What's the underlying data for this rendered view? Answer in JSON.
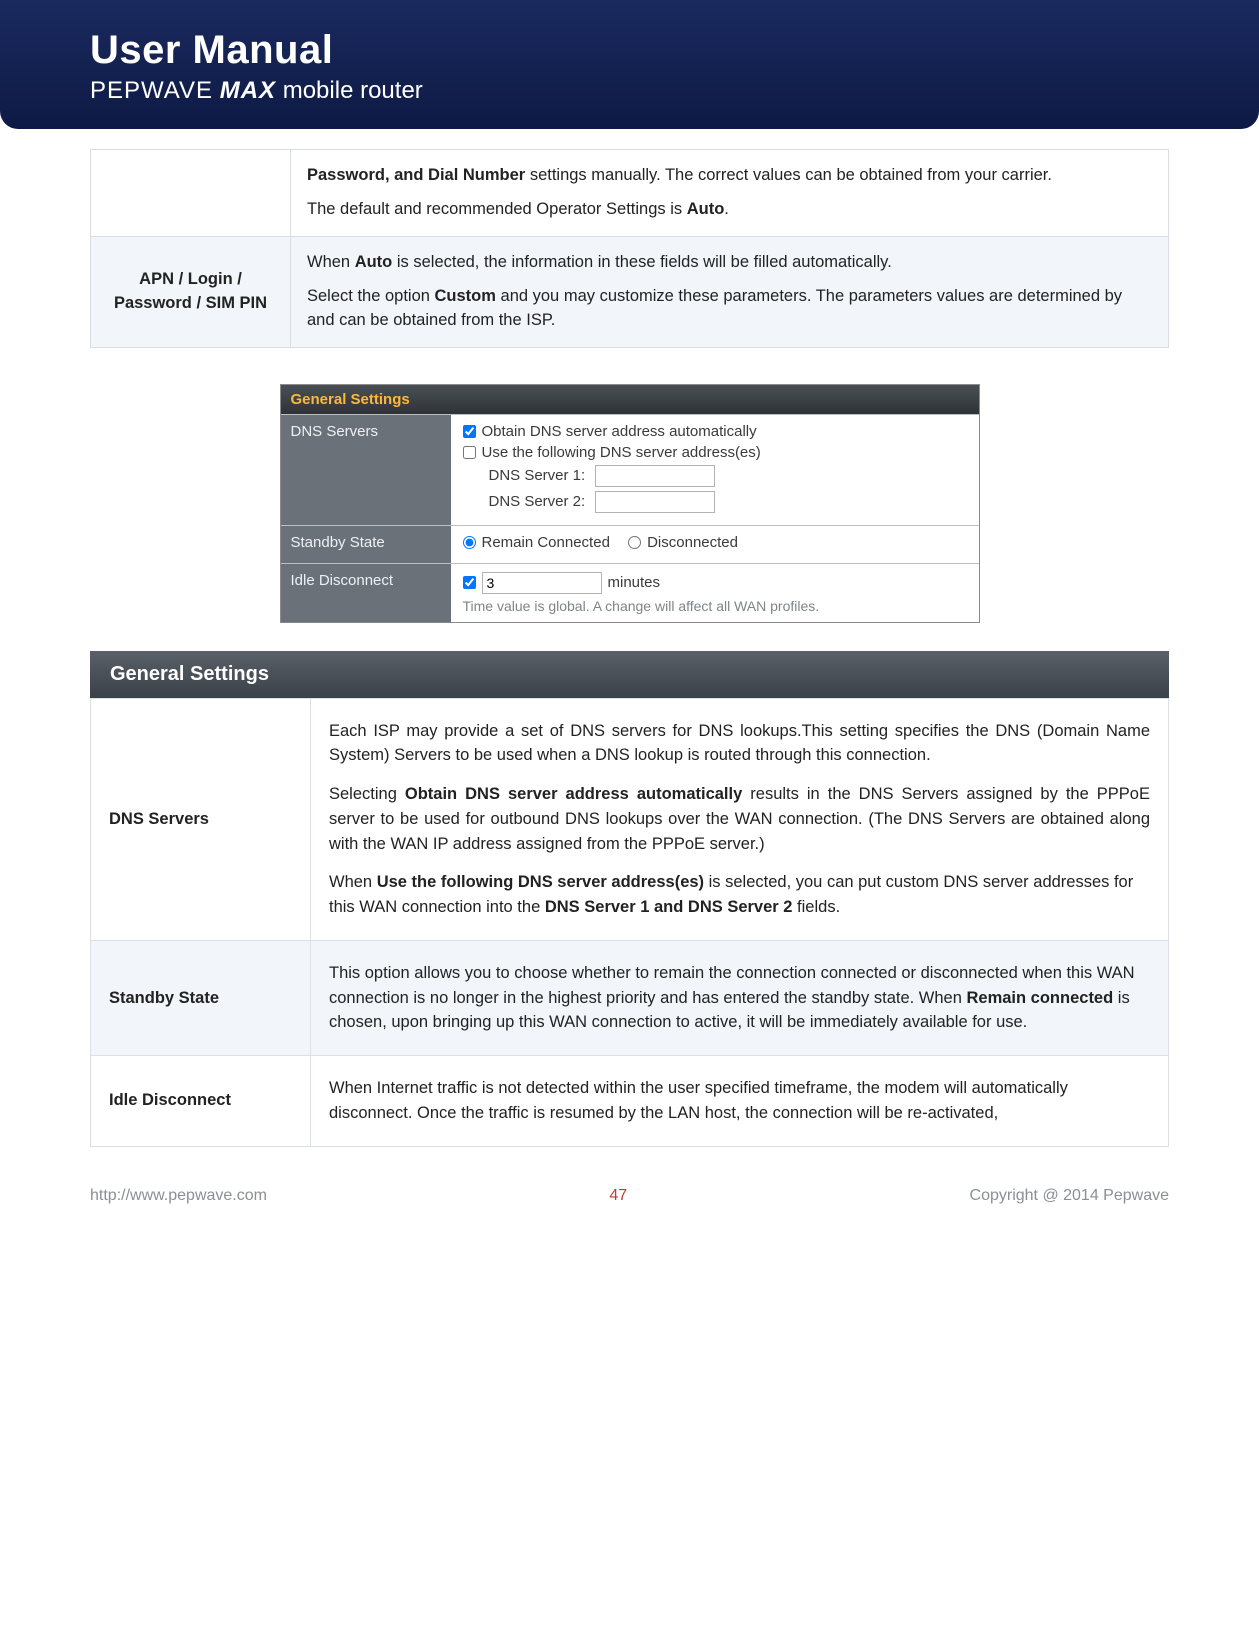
{
  "header": {
    "title": "User Manual",
    "subtitle_pep": "PEPWAVE",
    "subtitle_max": "MAX",
    "subtitle_mr": "mobile router"
  },
  "top_table": {
    "row1_label": "",
    "row1_p1_prefix": "Password, and Dial Number",
    "row1_p1_rest": " settings manually. The correct values can be obtained from your carrier.",
    "row1_p2_a": "The default and recommended Operator Settings is ",
    "row1_p2_b": "Auto",
    "row1_p2_c": ".",
    "row2_label": "APN / Login / Password / SIM PIN",
    "row2_p1_a": "When ",
    "row2_p1_b": "Auto",
    "row2_p1_c": " is selected, the information in these fields will be filled automatically.",
    "row2_p2_a": "Select the option ",
    "row2_p2_b": "Custom",
    "row2_p2_c": " and you may customize these parameters. The parameters values are determined by and can be obtained from the ISP."
  },
  "ui": {
    "title": "General Settings",
    "dns_label": "DNS Servers",
    "dns_opt1": "Obtain DNS server address automatically",
    "dns_opt2": "Use the following DNS server address(es)",
    "dns_s1_label": "DNS Server 1:",
    "dns_s2_label": "DNS Server 2:",
    "dns_s1_value": "",
    "dns_s2_value": "",
    "standby_label": "Standby State",
    "standby_opt1": "Remain Connected",
    "standby_opt2": "Disconnected",
    "idle_label": "Idle Disconnect",
    "idle_value": "3",
    "idle_unit": "minutes",
    "idle_hint": "Time value is global. A change will affect all WAN profiles."
  },
  "section_title": "General Settings",
  "desc": {
    "dns_label": "DNS Servers",
    "dns_p1": "Each ISP may provide a set of DNS servers for DNS lookups.This setting specifies the DNS (Domain Name System) Servers to be used when a DNS lookup is routed through this connection.",
    "dns_p2_a": "Selecting ",
    "dns_p2_b": "Obtain DNS server address automatically",
    "dns_p2_c": " results in the DNS Servers assigned by the PPPoE server to be used for outbound DNS lookups over the WAN connection.  (The DNS Servers are obtained along with the WAN IP address assigned from the PPPoE server.)",
    "dns_p3_a": "When ",
    "dns_p3_b": "Use the following DNS server address(es)",
    "dns_p3_c": " is selected, you can put custom DNS server addresses for this WAN connection into the ",
    "dns_p3_d": "DNS Server 1 and DNS Server 2",
    "dns_p3_e": " fields.",
    "standby_label": "Standby State",
    "standby_p_a": "This option allows you to choose whether to remain the connection connected or disconnected when this WAN connection is no longer in the highest priority and has entered the standby state. When ",
    "standby_p_b": "Remain connected",
    "standby_p_c": " is chosen, upon bringing up this WAN connection to active, it will be immediately available for use.",
    "idle_label": "Idle Disconnect",
    "idle_p": " When Internet traffic is not detected within the user specified timeframe, the modem will automatically disconnect. Once the traffic is resumed by the LAN host, the connection will be re-activated,"
  },
  "footer": {
    "url": "http://www.pepwave.com",
    "page": "47",
    "copyright": "Copyright @ 2014 Pepwave"
  }
}
